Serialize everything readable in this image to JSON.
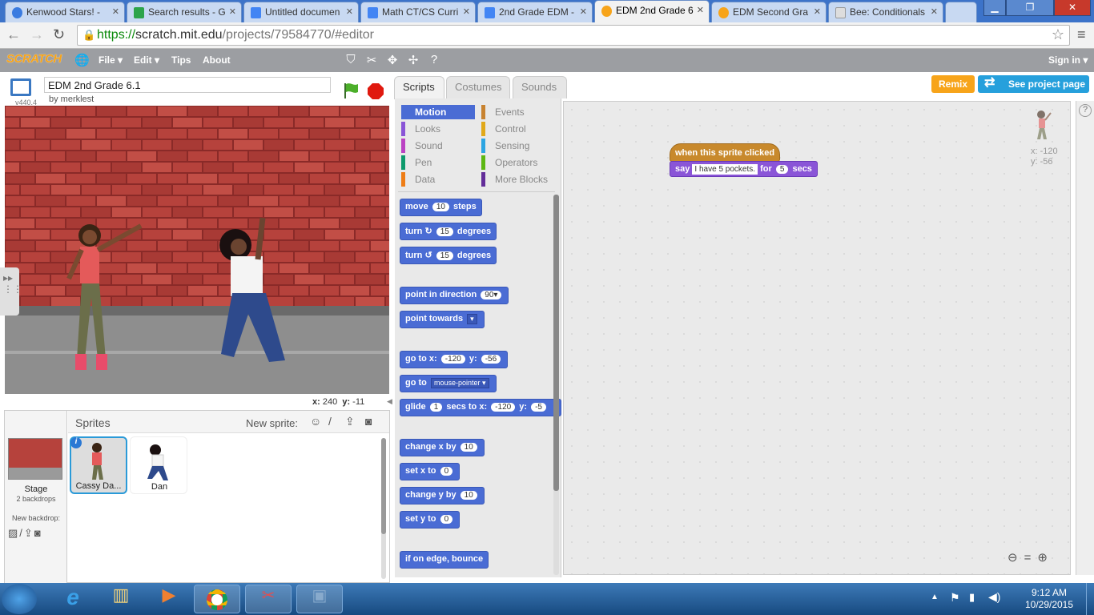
{
  "browser": {
    "tabs": [
      {
        "label": "Kenwood Stars! -",
        "icon_color": "#3a7be0"
      },
      {
        "label": "Search results - G",
        "icon_color": "#2da44a"
      },
      {
        "label": "Untitled documen",
        "icon_color": "#4285f4"
      },
      {
        "label": "Math CT/CS Curri",
        "icon_color": "#4285f4"
      },
      {
        "label": "2nd Grade EDM -",
        "icon_color": "#4285f4"
      },
      {
        "label": "EDM 2nd Grade 6",
        "icon_color": "#f7a41a",
        "active": true
      },
      {
        "label": "EDM Second Gra",
        "icon_color": "#f7a41a"
      },
      {
        "label": "Bee: Conditionals",
        "icon_color": "#dddddd"
      }
    ],
    "url_https": "https://",
    "url_domain": "scratch.mit.edu",
    "url_path": "/projects/79584770/#editor"
  },
  "scratch": {
    "logo": "SCRATCH",
    "menu": {
      "file": "File ▾",
      "edit": "Edit ▾",
      "tips": "Tips",
      "about": "About",
      "signin": "Sign in ▾"
    },
    "project_title": "EDM 2nd Grade 6.1",
    "author": "by merklest",
    "version": "v440.4",
    "remix": "Remix",
    "see_project": "See project page",
    "tabs": {
      "scripts": "Scripts",
      "costumes": "Costumes",
      "sounds": "Sounds"
    },
    "stage_coords": {
      "x_label": "x:",
      "x": "240",
      "y_label": "y:",
      "y": "-11"
    },
    "sprites": {
      "header": "Sprites",
      "new_sprite": "New sprite:",
      "stage_label": "Stage",
      "backdrops": "2 backdrops",
      "new_backdrop": "New backdrop:",
      "items": [
        {
          "name": "Cassy Da..."
        },
        {
          "name": "Dan"
        }
      ]
    },
    "categories": {
      "left": [
        "Motion",
        "Looks",
        "Sound",
        "Pen",
        "Data"
      ],
      "right": [
        "Events",
        "Control",
        "Sensing",
        "Operators",
        "More Blocks"
      ],
      "left_colors": [
        "#4a6cd4",
        "#8a55d7",
        "#bb42c3",
        "#0e9a6c",
        "#ee7d16"
      ],
      "right_colors": [
        "#c88330",
        "#e1a91a",
        "#2ca5e2",
        "#5cb712",
        "#632d99"
      ]
    },
    "blocks": {
      "move": [
        "move",
        "10",
        "steps"
      ],
      "turn_right": [
        "turn",
        "↻",
        "15",
        "degrees"
      ],
      "turn_left": [
        "turn",
        "↺",
        "15",
        "degrees"
      ],
      "point_dir": [
        "point in direction",
        "90▾"
      ],
      "point_towards": [
        "point towards",
        "▾"
      ],
      "goto_xy": [
        "go to x:",
        "-120",
        "y:",
        "-56"
      ],
      "goto": [
        "go to",
        "mouse-pointer ▾"
      ],
      "glide": [
        "glide",
        "1",
        "secs to x:",
        "-120",
        "y:",
        "-5"
      ],
      "change_x": [
        "change x by",
        "10"
      ],
      "set_x": [
        "set x to",
        "0"
      ],
      "change_y": [
        "change y by",
        "10"
      ],
      "set_y": [
        "set y to",
        "0"
      ],
      "bounce": [
        "if on edge, bounce"
      ]
    },
    "script": {
      "hat": "when this sprite clicked",
      "say": "say",
      "say_text": "I have 5 pockets.",
      "for": "for",
      "secs_val": "5",
      "secs": "secs"
    },
    "sprite_pos": {
      "x": "x: -120",
      "y": "y: -56"
    }
  },
  "taskbar": {
    "time": "9:12 AM",
    "date": "10/29/2015"
  }
}
